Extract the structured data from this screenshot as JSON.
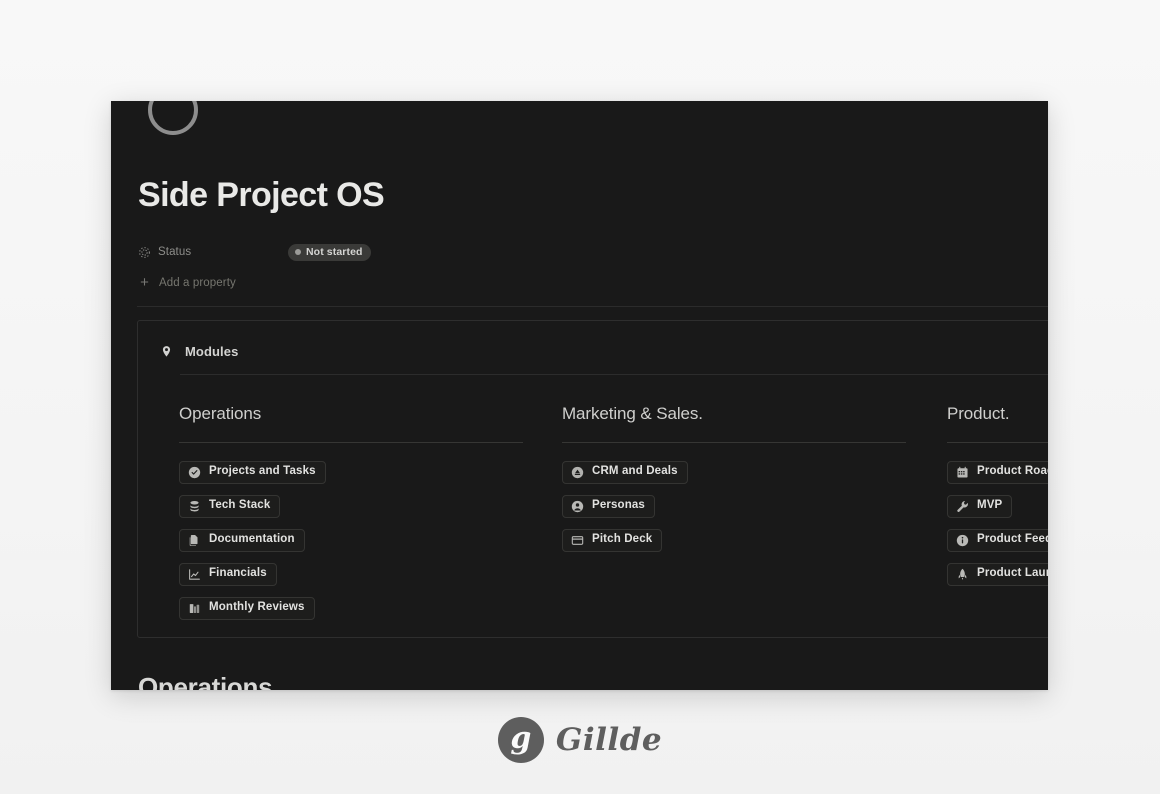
{
  "page": {
    "title": "Side Project OS",
    "icon": "circle-outline-icon"
  },
  "properties": {
    "status": {
      "icon": "status-gear-icon",
      "label": "Status",
      "value": "Not started"
    },
    "add_property_label": "Add a property"
  },
  "modules_block": {
    "icon": "pin-icon",
    "title": "Modules",
    "columns": [
      {
        "title": "Operations",
        "items": [
          {
            "icon": "check-circle-icon",
            "label": "Projects and Tasks"
          },
          {
            "icon": "database-icon",
            "label": "Tech Stack"
          },
          {
            "icon": "documents-icon",
            "label": "Documentation"
          },
          {
            "icon": "chart-line-icon",
            "label": "Financials"
          },
          {
            "icon": "clipboard-chart-icon",
            "label": "Monthly Reviews"
          }
        ]
      },
      {
        "title": "Marketing & Sales.",
        "items": [
          {
            "icon": "cloud-arrow-icon",
            "label": "CRM and Deals"
          },
          {
            "icon": "person-circle-icon",
            "label": "Personas"
          },
          {
            "icon": "window-card-icon",
            "label": "Pitch Deck"
          }
        ]
      },
      {
        "title": "Product.",
        "items": [
          {
            "icon": "calendar-icon",
            "label": "Product Roadmap"
          },
          {
            "icon": "wrench-icon",
            "label": "MVP"
          },
          {
            "icon": "info-circle-icon",
            "label": "Product Feedback"
          },
          {
            "icon": "rocket-icon",
            "label": "Product Launch"
          }
        ]
      }
    ]
  },
  "section_heading": "Operations",
  "brand": {
    "mark_letter": "g",
    "name": "Gillde"
  },
  "colors": {
    "page_background": "#f7f7f7",
    "panel_background": "#191919",
    "chip_background": "#1d1d1c",
    "chip_border": "#343432",
    "status_pill_background": "#3a3a38",
    "text_primary": "#e9e9e7",
    "text_muted": "#8d8d8a",
    "brand_gray": "#5e5e5e"
  }
}
